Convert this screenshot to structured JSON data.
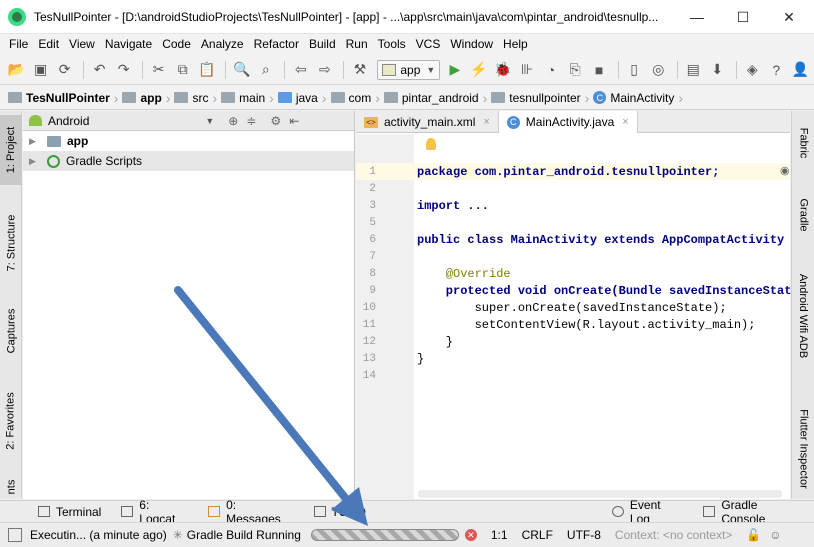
{
  "window": {
    "title": "TesNullPointer - [D:\\androidStudioProjects\\TesNullPointer] - [app] - ...\\app\\src\\main\\java\\com\\pintar_android\\tesnullp...",
    "minimize": "—",
    "maximize": "☐",
    "close": "✕"
  },
  "menu": [
    "File",
    "Edit",
    "View",
    "Navigate",
    "Code",
    "Analyze",
    "Refactor",
    "Build",
    "Run",
    "Tools",
    "VCS",
    "Window",
    "Help"
  ],
  "toolbar": {
    "run_config": "app"
  },
  "breadcrumb": [
    "TesNullPointer",
    "app",
    "src",
    "main",
    "java",
    "com",
    "pintar_android",
    "tesnullpointer",
    "MainActivity"
  ],
  "left_tabs": [
    "1: Project",
    "7: Structure",
    "Captures",
    "2: Favorites",
    "nts"
  ],
  "right_tabs": [
    "Fabric",
    "Gradle",
    "Android Wifi ADB",
    "Flutter Inspector"
  ],
  "project_panel": {
    "view": "Android",
    "items": [
      {
        "label": "app"
      },
      {
        "label": "Gradle Scripts"
      }
    ]
  },
  "editor": {
    "tabs": [
      {
        "label": "activity_main.xml"
      },
      {
        "label": "MainActivity.java"
      }
    ],
    "lines": [
      {
        "n": "1",
        "text": "package com.pintar_android.tesnullpointer;"
      },
      {
        "n": "2",
        "text": ""
      },
      {
        "n": "3",
        "text": "import ..."
      },
      {
        "n": "5",
        "text": ""
      },
      {
        "n": "6",
        "text": "public class MainActivity extends AppCompatActivity {"
      },
      {
        "n": "7",
        "text": ""
      },
      {
        "n": "8",
        "text": "    @Override"
      },
      {
        "n": "9",
        "text": "    protected void onCreate(Bundle savedInstanceState"
      },
      {
        "n": "10",
        "text": "        super.onCreate(savedInstanceState);"
      },
      {
        "n": "11",
        "text": "        setContentView(R.layout.activity_main);"
      },
      {
        "n": "12",
        "text": "    }"
      },
      {
        "n": "13",
        "text": "}"
      },
      {
        "n": "14",
        "text": ""
      }
    ]
  },
  "bottom_tabs": {
    "terminal": "Terminal",
    "logcat": "6: Logcat",
    "messages": "0: Messages",
    "todo": "TODO",
    "event_log": "Event Log",
    "gradle_console": "Gradle Console"
  },
  "status": {
    "executing": "Executin... (a minute ago)",
    "gradle": "Gradle Build Running",
    "position": "1:1",
    "line_sep": "CRLF",
    "encoding": "UTF-8",
    "context": "Context: <no context>"
  },
  "colors": {
    "arrow": "#4a78b8",
    "accent": "#3c9a3c"
  }
}
